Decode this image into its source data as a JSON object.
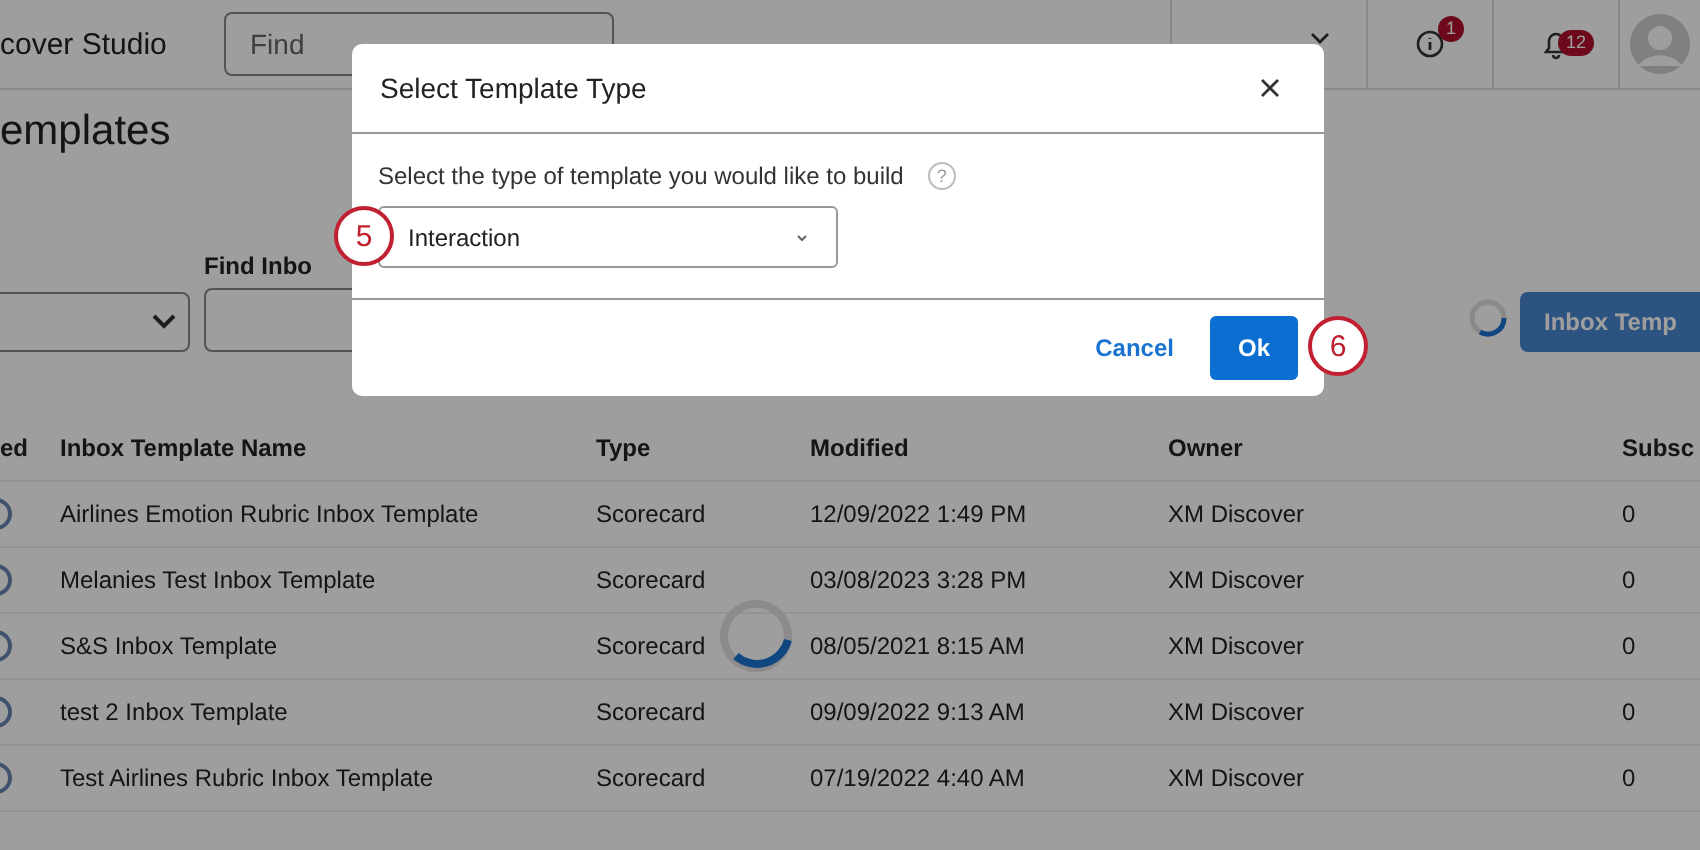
{
  "header": {
    "brand": "cover Studio",
    "search": {
      "placeholder": "Find"
    },
    "info_badge": "1",
    "notification_badge": "12"
  },
  "page_title": "emplates",
  "toolbar": {
    "find_label": "Find Inbo",
    "action_button": "Inbox Temp",
    "loading": true
  },
  "table": {
    "columns": [
      "ed",
      "Inbox Template Name",
      "Type",
      "Modified",
      "Owner",
      "Subsc"
    ],
    "rows": [
      {
        "selected": false,
        "cells": [
          "",
          "Airlines Emotion Rubric Inbox Template",
          "Scorecard",
          "12/09/2022 1:49 PM",
          "XM Discover",
          "0"
        ]
      },
      {
        "selected": false,
        "cells": [
          "",
          "Melanies Test Inbox Template",
          "Scorecard",
          "03/08/2023 3:28 PM",
          "XM Discover",
          "0"
        ]
      },
      {
        "selected": false,
        "cells": [
          "",
          "S&S Inbox Template",
          "Scorecard",
          "08/05/2021 8:15 AM",
          "XM Discover",
          "0"
        ]
      },
      {
        "selected": false,
        "cells": [
          "",
          "test 2 Inbox Template",
          "Scorecard",
          "09/09/2022 9:13 AM",
          "XM Discover",
          "0"
        ]
      },
      {
        "selected": false,
        "cells": [
          "",
          "Test Airlines Rubric Inbox Template",
          "Scorecard",
          "07/19/2022 4:40 AM",
          "XM Discover",
          "0"
        ]
      }
    ]
  },
  "table_loading": true,
  "dialog": {
    "title": "Select Template Type",
    "prompt": "Select the type of template you would like to build",
    "help": "?",
    "select_value": "Interaction",
    "buttons": [
      {
        "label": "Cancel",
        "kind": "link"
      },
      {
        "label": "Ok",
        "kind": "primary"
      }
    ]
  },
  "callouts": [
    "5",
    "6"
  ]
}
